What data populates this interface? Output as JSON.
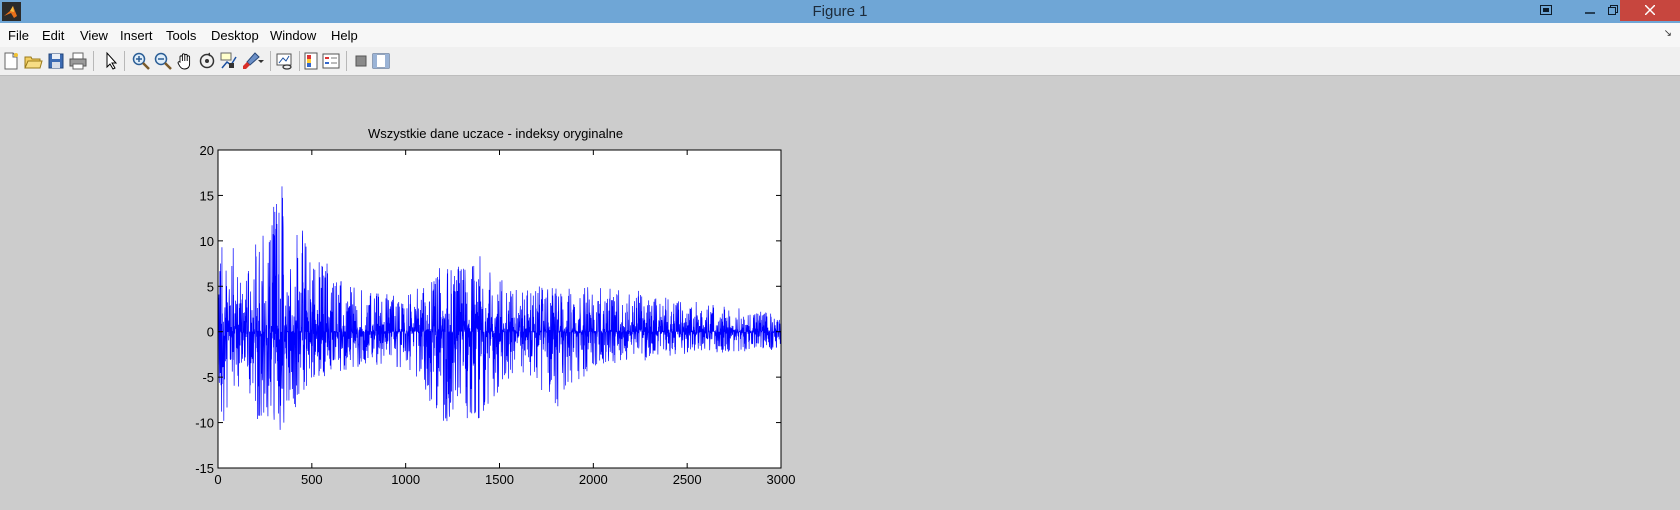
{
  "window": {
    "title": "Figure 1",
    "controls": [
      "minimize",
      "restore",
      "close"
    ]
  },
  "menu": {
    "items": [
      "File",
      "Edit",
      "View",
      "Insert",
      "Tools",
      "Desktop",
      "Window",
      "Help"
    ]
  },
  "toolbar": {
    "buttons": [
      "new-figure-icon",
      "open-file-icon",
      "save-icon",
      "print-icon",
      "edit-plot-arrow-icon",
      "zoom-in-icon",
      "zoom-out-icon",
      "pan-hand-icon",
      "rotate-3d-icon",
      "data-cursor-icon",
      "brush-icon",
      "link-plot-icon",
      "insert-colorbar-icon",
      "insert-legend-icon",
      "hide-plot-tools-icon",
      "show-plot-tools-icon"
    ]
  },
  "chart_data": {
    "type": "line",
    "title": "Wszystkie dane uczace - indeksy oryginalne",
    "xlabel": "",
    "ylabel": "",
    "xlim": [
      0,
      3000
    ],
    "ylim": [
      -15,
      20
    ],
    "xticks": [
      0,
      500,
      1000,
      1500,
      2000,
      2500,
      3000
    ],
    "yticks": [
      20,
      15,
      10,
      5,
      0,
      -5,
      -10,
      -15
    ],
    "grid": false,
    "line_color": "#0000ff",
    "n_points": 3000,
    "envelope": [
      {
        "x": 0,
        "max": 9.5,
        "min": -10
      },
      {
        "x": 150,
        "max": 6,
        "min": -5
      },
      {
        "x": 200,
        "max": 10,
        "min": -10
      },
      {
        "x": 340,
        "max": 16,
        "min": -11
      },
      {
        "x": 500,
        "max": 9,
        "min": -6
      },
      {
        "x": 700,
        "max": 5,
        "min": -4
      },
      {
        "x": 1000,
        "max": 4,
        "min": -4
      },
      {
        "x": 1200,
        "max": 7,
        "min": -10
      },
      {
        "x": 1400,
        "max": 8.3,
        "min": -9.5
      },
      {
        "x": 1600,
        "max": 5,
        "min": -4
      },
      {
        "x": 1800,
        "max": 5,
        "min": -8
      },
      {
        "x": 2000,
        "max": 5,
        "min": -4
      },
      {
        "x": 2500,
        "max": 3.5,
        "min": -2.5
      },
      {
        "x": 3000,
        "max": 2,
        "min": -2
      }
    ],
    "spikes": [
      {
        "x": 20,
        "y": 9.3
      },
      {
        "x": 30,
        "y": -9.8
      },
      {
        "x": 80,
        "y": 9.2
      },
      {
        "x": 200,
        "y": 9.6
      },
      {
        "x": 210,
        "y": -9.6
      },
      {
        "x": 265,
        "y": -9.3
      },
      {
        "x": 340,
        "y": 16
      },
      {
        "x": 330,
        "y": -10.8
      },
      {
        "x": 350,
        "y": -10
      },
      {
        "x": 580,
        "y": 7.5
      },
      {
        "x": 1200,
        "y": -9.8
      },
      {
        "x": 1180,
        "y": 7
      },
      {
        "x": 1395,
        "y": 8.3
      },
      {
        "x": 1390,
        "y": -9.5
      },
      {
        "x": 1810,
        "y": -8.2
      },
      {
        "x": 1780,
        "y": 4.8
      },
      {
        "x": 2240,
        "y": 4.5
      }
    ]
  }
}
